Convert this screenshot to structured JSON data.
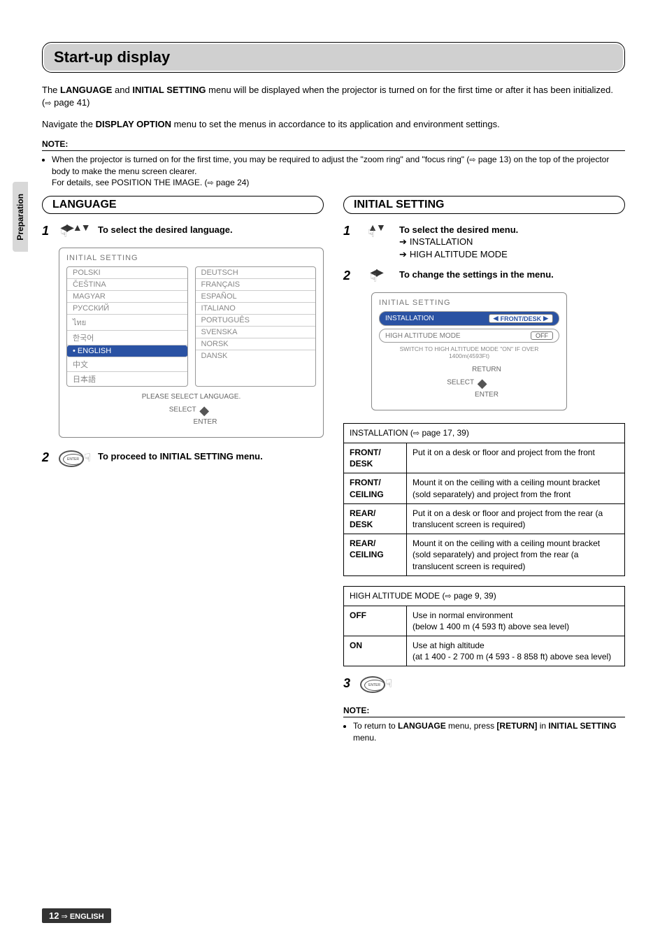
{
  "sidebar": {
    "label": "Preparation"
  },
  "title": "Start-up display",
  "intro": {
    "p1a": "The ",
    "p1b": "LANGUAGE",
    "p1c": " and ",
    "p1d": "INITIAL SETTING",
    "p1e": " menu will be displayed when the projector is turned on for the first time or after it has been initialized. (",
    "p1f": " page 41)",
    "p2a": "Navigate the ",
    "p2b": "DISPLAY OPTION",
    "p2c": " menu to set the menus in accordance to its application and environment settings."
  },
  "topnote": {
    "heading": "NOTE:",
    "bullet_a": "When the projector is turned on for the first time, you may be required to adjust the \"zoom ring\" and \"focus ring\" (",
    "bullet_b": " page 13) on the top of the projector body to make the menu screen clearer.",
    "bullet2a": "For details, see POSITION THE IMAGE. (",
    "bullet2b": " page 24)"
  },
  "lang": {
    "heading": "LANGUAGE",
    "step1": "To select the desired language.",
    "step2": "To proceed to INITIAL SETTING menu.",
    "osd_title": "INITIAL SETTING",
    "left_col": [
      "POLSKI",
      "ČEŠTINA",
      "MAGYAR",
      "РУССКИЙ",
      "ไทย",
      "한국어",
      "ENGLISH",
      "中文",
      "日本語"
    ],
    "right_col": [
      "DEUTSCH",
      "FRANÇAIS",
      "ESPAÑOL",
      "ITALIANO",
      "PORTUGUÊS",
      "SVENSKA",
      "NORSK",
      "DANSK"
    ],
    "footer1": "PLEASE SELECT LANGUAGE.",
    "footer_select": "SELECT",
    "footer_enter": "ENTER"
  },
  "init": {
    "heading": "INITIAL SETTING",
    "step1": "To select the desired menu.",
    "sub1": "INSTALLATION",
    "sub2": "HIGH ALTITUDE MODE",
    "step2": "To change the settings in the menu.",
    "osd_title": "INITIAL SETTING",
    "row1": "INSTALLATION",
    "row1_val": "FRONT/DESK",
    "row2": "HIGH ALTITUDE MODE",
    "row2_val": "OFF",
    "tiny": "SWITCH TO HIGH ALTITUDE MODE \"ON\" IF OVER 1400m(4593Ft)",
    "return": "RETURN",
    "select": "SELECT",
    "enter": "ENTER",
    "table1_caption": "INSTALLATION (",
    "table1_caption_b": " page 17, 39)",
    "t1": [
      {
        "h": "FRONT/\nDESK",
        "d": "Put it on a desk or floor and project from the front"
      },
      {
        "h": "FRONT/\nCEILING",
        "d": "Mount it on the ceiling with a ceiling mount bracket (sold separately) and project from the front"
      },
      {
        "h": "REAR/\nDESK",
        "d": "Put it on a desk or floor and project from the rear (a translucent screen is required)"
      },
      {
        "h": "REAR/\nCEILING",
        "d": "Mount it on the ceiling with a ceiling mount bracket (sold separately) and project from the rear (a translucent screen is required)"
      }
    ],
    "table2_caption": "HIGH ALTITUDE MODE (",
    "table2_caption_b": " page 9, 39)",
    "t2": [
      {
        "h": "OFF",
        "d": "Use in normal environment\n(below 1 400 m (4 593 ft) above sea level)"
      },
      {
        "h": "ON",
        "d": "Use at high altitude\n(at 1 400 - 2 700 m (4 593 - 8 858 ft) above sea level)"
      }
    ]
  },
  "bottomnote": {
    "heading": "NOTE:",
    "line_a": "To return to ",
    "line_b": "LANGUAGE",
    "line_c": " menu, press ",
    "line_d": "[RETURN]",
    "line_e": " in ",
    "line_f": "INITIAL SETTING",
    "line_g": " menu."
  },
  "footer": {
    "page": "12",
    "arrow": "⇨",
    "lang": "ENGLISH"
  }
}
